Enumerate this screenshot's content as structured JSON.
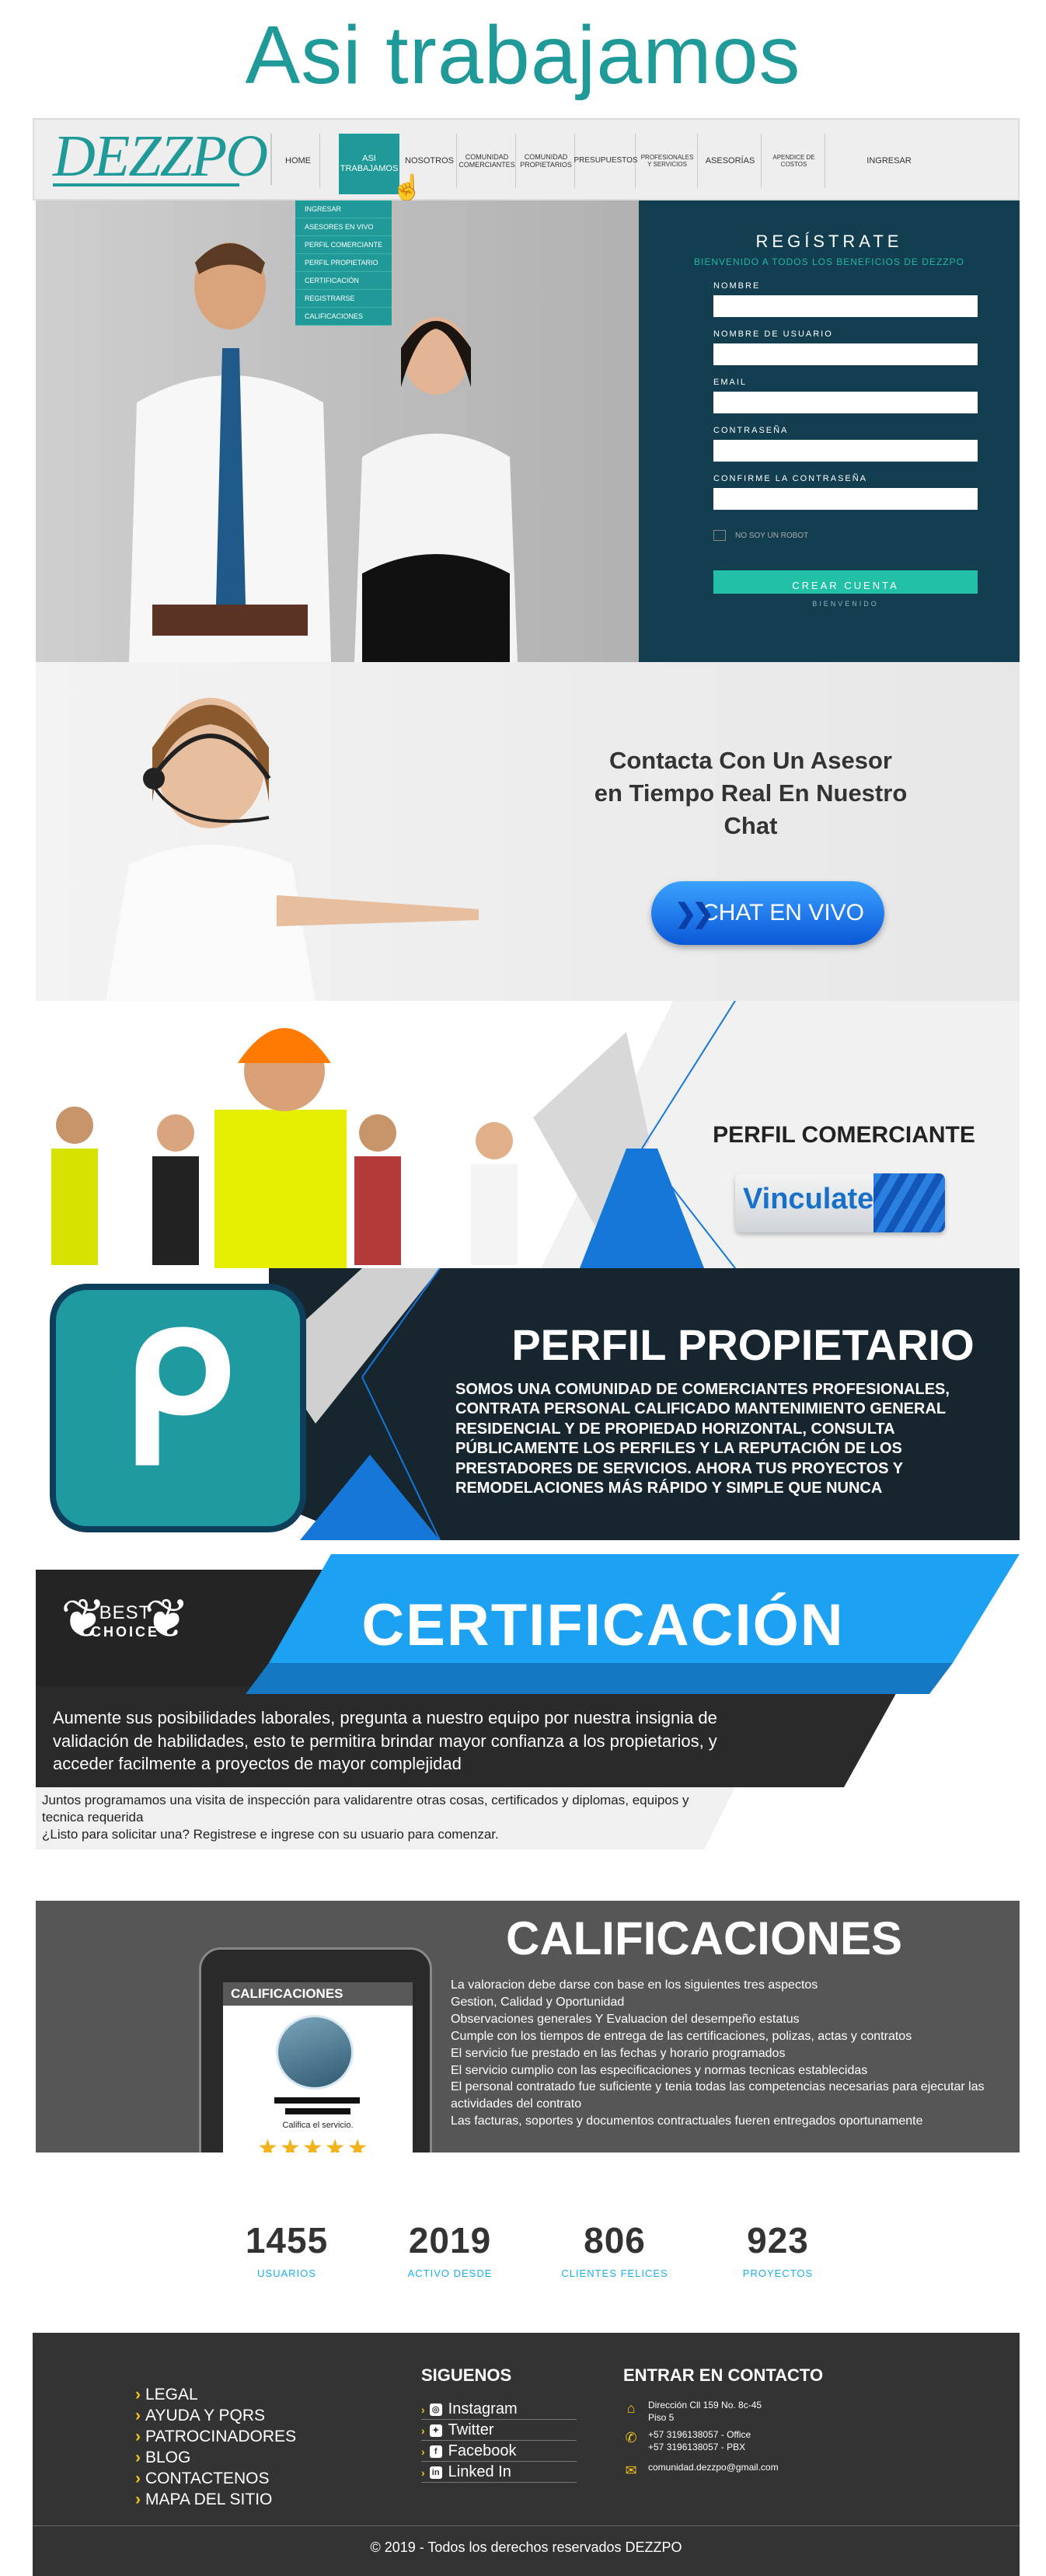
{
  "page_title": "Asi trabajamos",
  "nav": {
    "logo": "DEZZPO",
    "items": [
      "HOME",
      "ASI TRABAJAMOS",
      "NOSOTROS",
      "COMUNIDAD COMERCIANTES",
      "COMUNIDAD PROPIETARIOS",
      "PRESUPUESTOS",
      "PROFESIONALES Y SERVICIOS",
      "ASESORÍAS",
      "APENDICE DE COSTOS",
      "INGRESAR"
    ],
    "active": "ASI TRABAJAMOS",
    "dropdown": [
      "INGRESAR",
      "ASESORES EN VIVO",
      "PERFIL COMERCIANTE",
      "PERFIL PROPIETARIO",
      "CERTIFICACIÓN",
      "REGISTRARSE",
      "CALIFICACIONES"
    ]
  },
  "register": {
    "title": "REGÍSTRATE",
    "subtitle": "BIENVENIDO A TODOS LOS BENEFICIOS DE DEZZPO",
    "fields": [
      "NOMBRE",
      "NOMBRE DE USUARIO",
      "EMAIL",
      "CONTRASEÑA",
      "CONFIRME LA CONTRASEÑA"
    ],
    "robot": "NO SOY UN ROBOT",
    "button": "CREAR CUENTA",
    "welcome": "BIENVENIDO"
  },
  "chat": {
    "title_line1": "Contacta Con Un Asesor",
    "title_line2": "en Tiempo Real En Nuestro Chat",
    "button": "CHAT EN VIVO"
  },
  "comerciante": {
    "title": "PERFIL COMERCIANTE",
    "button": "Vinculate"
  },
  "propietario": {
    "title": "PERFIL PROPIETARIO",
    "text": "SOMOS UNA COMUNIDAD DE COMERCIANTES PROFESIONALES, CONTRATA PERSONAL CALIFICADO MANTENIMIENTO GENERAL RESIDENCIAL Y DE PROPIEDAD HORIZONTAL, CONSULTA PÚBLICAMENTE LOS PERFILES Y LA REPUTACIÓN DE LOS PRESTADORES DE SERVICIOS. AHORA TUS PROYECTOS Y REMODELACIONES MÁS RÁPIDO Y SIMPLE QUE NUNCA"
  },
  "certificacion": {
    "badge_best": "BEST",
    "badge_choice": "CHOICE",
    "title": "CERTIFICACIÓN",
    "text1": "Aumente sus posibilidades laborales, pregunta a nuestro equipo por nuestra insignia de validación de habilidades, esto te permitira brindar mayor confianza a los propietarios, y acceder facilmente a proyectos de mayor complejidad",
    "text2_line1": "Juntos programamos una visita de inspección para validarentre otras cosas, certificados y  diplomas, equipos y tecnica requerida",
    "text2_line2": "¿Listo para solicitar una? Registrese e ingrese con su usuario para comenzar."
  },
  "calificaciones": {
    "title": "CALIFICACIONES",
    "phone_header": "CALIFICACIONES",
    "phone_caption": "Califica el servicio.",
    "lines": [
      "La valoracion debe darse con base en los siguientes tres aspectos",
      "Gestion, Calidad y Oportunidad",
      "Observaciones generales  Y Evaluacion del desempeño estatus",
      "Cumple con los tiempos de entrega de las certificaciones, polizas, actas y contratos",
      "El servicio fue prestado en las fechas  y horario programados",
      "El servicio cumplio con las especificaciones y normas tecnicas establecidas",
      "El personal contratado fue suficiente y tenia todas las competencias necesarias para ejecutar las actividades del contrato",
      "Las facturas, soportes y documentos contractuales fueren entregados oportunamente"
    ]
  },
  "stats": [
    {
      "number": "1455",
      "label": "USUARIOS"
    },
    {
      "number": "2019",
      "label": "ACTIVO DESDE"
    },
    {
      "number": "806",
      "label": "CLIENTES FELICES"
    },
    {
      "number": "923",
      "label": "PROYECTOS"
    }
  ],
  "footer": {
    "links": [
      "LEGAL",
      "AYUDA Y PQRS",
      "PATROCINADORES",
      "BLOG",
      "CONTACTENOS",
      "MAPA DEL SITIO"
    ],
    "social_title": "SIGUENOS",
    "social": [
      "Instagram",
      "Twitter",
      "Facebook",
      "Linked In"
    ],
    "contact_title": "ENTRAR EN CONTACTO",
    "address_line1": "Dirección  Cll 159 No. 8c-45",
    "address_line2": "Piso 5",
    "phone1": "+57 3196138057 - Office",
    "phone2": "+57 3196138057 - PBX",
    "email": "comunidad.dezzpo@gmail.com",
    "copyright": "© 2019 - Todos los derechos reservados DEZZPO"
  },
  "colors": {
    "teal": "#1f9a98",
    "navy": "#123e50",
    "dark": "#333333",
    "blue": "#1ab0ea"
  }
}
